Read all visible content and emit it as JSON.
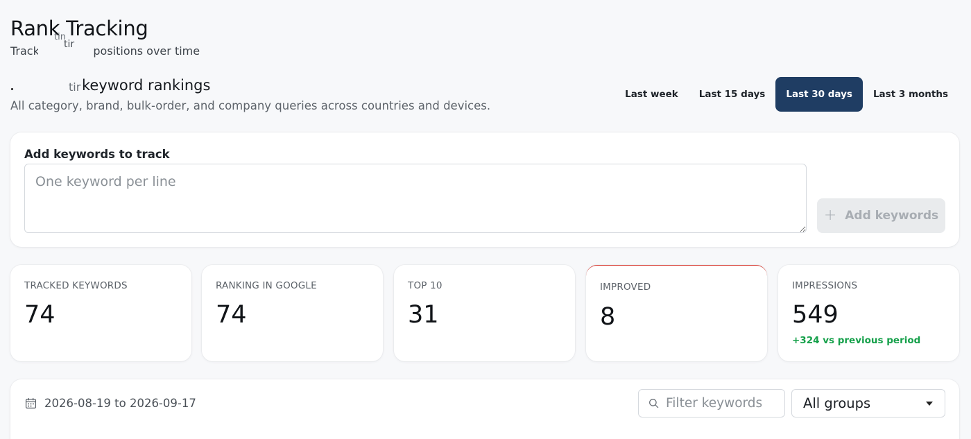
{
  "header": {
    "title": "Rank Tracking",
    "subtitle": "Track  keyword positions over time",
    "subtitle_fragment_top": "tin",
    "subtitle_fragment_mid": "tir"
  },
  "rankings": {
    "title": "keyword rankings",
    "title_fragment": "tir",
    "description": "All category, brand, bulk-order, and company queries across countries and devices."
  },
  "date_range_tabs": [
    {
      "label": "Last week",
      "active": false
    },
    {
      "label": "Last 15 days",
      "active": false
    },
    {
      "label": "Last 30 days",
      "active": true
    },
    {
      "label": "Last 3 months",
      "active": false
    }
  ],
  "add_keywords": {
    "label": "Add keywords to track",
    "placeholder": "One keyword per line",
    "value": "",
    "button_label": "Add keywords",
    "button_icon": "plus-icon"
  },
  "stats": [
    {
      "label": "TRACKED KEYWORDS",
      "value": "74"
    },
    {
      "label": "RANKING IN GOOGLE",
      "value": "74"
    },
    {
      "label": "TOP 10",
      "value": "31"
    },
    {
      "label": "IMPROVED",
      "value": "8"
    },
    {
      "label": "IMPRESSIONS",
      "value": "549",
      "delta": "+324 vs previous period"
    }
  ],
  "table_toolbar": {
    "date_range": "2026-08-19 to 2026-09-17",
    "calendar_icon": "calendar-icon",
    "filter_placeholder": "Filter keywords",
    "filter_value": "",
    "filter_icon": "search-icon",
    "group_selected": "All groups"
  },
  "colors": {
    "active_tab": "#1f3d63",
    "delta_positive": "#15a04a",
    "improved_accent": "#d6342b"
  }
}
